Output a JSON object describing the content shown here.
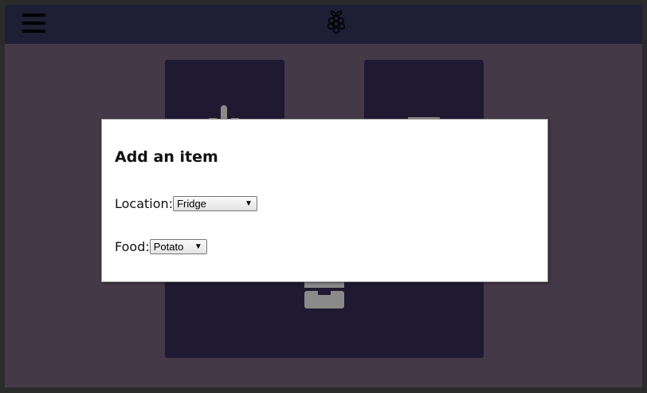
{
  "header": {
    "logo_icon": "raspberry-pi-logo-icon",
    "menu_icon": "hamburger-menu-icon"
  },
  "tiles": [
    {
      "icon": "thermometer-icon"
    },
    {
      "icon": "box-icon"
    },
    {
      "icon": "drawer-icon"
    }
  ],
  "modal": {
    "title": "Add an item",
    "location": {
      "label": "Location:",
      "value": "Fridge"
    },
    "food": {
      "label": "Food:",
      "value": "Potato"
    }
  },
  "colors": {
    "header_bg": "#1e1e35",
    "page_bg": "#443947",
    "tile_bg": "#1f1a32",
    "modal_bg": "#ffffff"
  }
}
